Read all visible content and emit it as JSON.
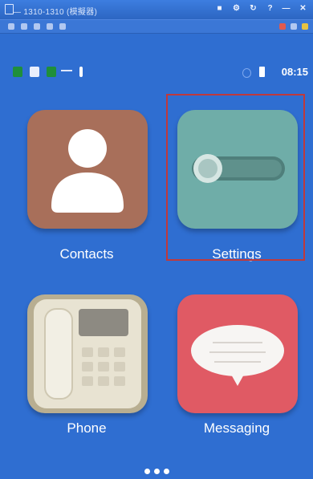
{
  "window": {
    "title": "— 1310-1310 (模擬器)",
    "controls": [
      "minimize-icon",
      "close-icon"
    ]
  },
  "status_bar": {
    "time": "08:15"
  },
  "apps": [
    {
      "label": "Contacts",
      "icon": "contacts-icon",
      "color": "#a86f5a"
    },
    {
      "label": "Settings",
      "icon": "settings-icon",
      "color": "#6fada8",
      "highlighted": true
    },
    {
      "label": "Phone",
      "icon": "phone-icon",
      "color": "#b8ae91"
    },
    {
      "label": "Messaging",
      "icon": "messaging-icon",
      "color": "#e05a64"
    }
  ],
  "colors": {
    "background": "#2f6ed1",
    "highlight": "#c0393b"
  }
}
